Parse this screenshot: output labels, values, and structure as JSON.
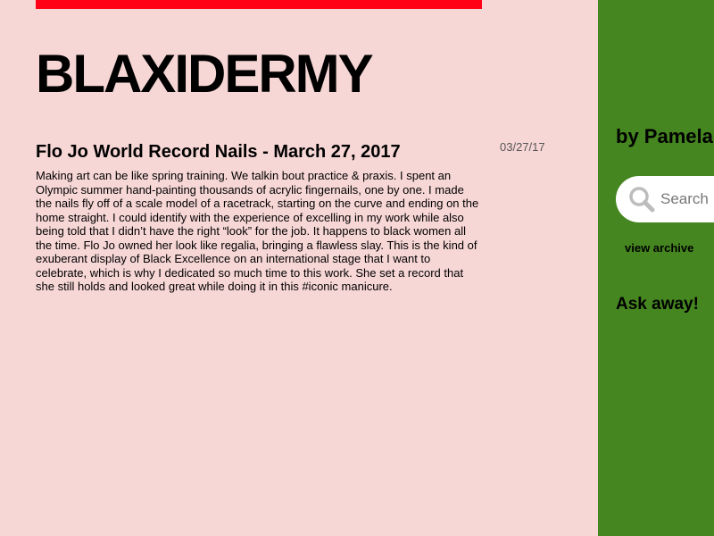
{
  "blog": {
    "title": "BLAXIDERMY"
  },
  "post": {
    "title": "Flo Jo World Record Nails - March 27, 2017",
    "date": "03/27/17",
    "body": "Making art can be like spring training. We talkin bout practice & praxis. I spent an Olympic summer hand-painting thousands of acrylic fingernails, one by one. I made the nails fly off of a scale model of a racetrack, starting on the curve and ending on the home straight. I could identify with the experience of excelling in my work while also being told that I didn’t have the right “look” for the job. It happens to black women all the time. Flo Jo owned her look like regalia, bringing a flawless slay. This is the kind of exuberant display of Black Excellence on an international stage that I want to celebrate, which is why I dedicated so much time to this work. She set a record that she still holds and looked great while doing it in this #iconic manicure."
  },
  "sidebar": {
    "byline": "by Pamela",
    "search": {
      "placeholder": "Search",
      "value": ""
    },
    "archive_label": "view archive",
    "ask_label": "Ask away!"
  },
  "colors": {
    "page_background": "#f7d7d6",
    "accent_bar": "#ff0016",
    "sidebar_background": "#458620"
  },
  "icons": {
    "search": "search-icon"
  }
}
